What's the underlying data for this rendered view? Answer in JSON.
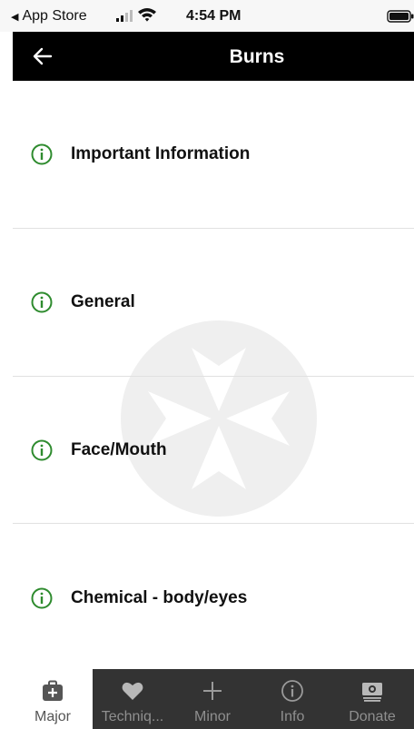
{
  "status_bar": {
    "back_label": "App Store",
    "time": "4:54 PM"
  },
  "header": {
    "title": "Burns"
  },
  "sections": [
    {
      "label": "Important Information",
      "icon": "info-circle-icon"
    },
    {
      "label": "General",
      "icon": "info-circle-icon"
    },
    {
      "label": "Face/Mouth",
      "icon": "info-circle-icon"
    },
    {
      "label": "Chemical - body/eyes",
      "icon": "info-circle-icon"
    }
  ],
  "tabs": [
    {
      "label": "Major",
      "icon": "first-aid-kit-icon",
      "active": true
    },
    {
      "label": "Techniq...",
      "icon": "heart-icon",
      "active": false
    },
    {
      "label": "Minor",
      "icon": "plus-icon",
      "active": false
    },
    {
      "label": "Info",
      "icon": "info-circle-icon",
      "active": false
    },
    {
      "label": "Donate",
      "icon": "cash-icon",
      "active": false
    }
  ],
  "colors": {
    "header_bg": "#000000",
    "accent_green": "#2e8b2e",
    "tab_bar_bg": "#333333",
    "tab_inactive": "#8f8f8f"
  }
}
